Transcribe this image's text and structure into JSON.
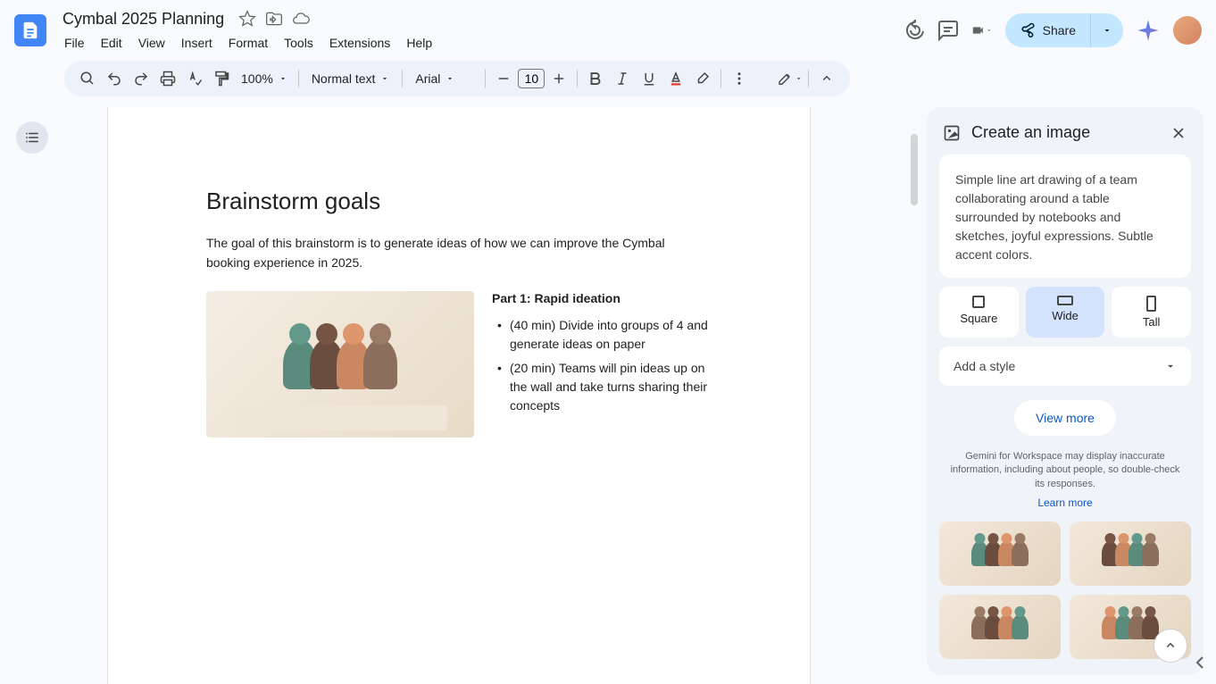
{
  "document": {
    "title": "Cymbal 2025 Planning",
    "menus": [
      "File",
      "Edit",
      "View",
      "Insert",
      "Format",
      "Tools",
      "Extensions",
      "Help"
    ]
  },
  "header": {
    "share_label": "Share"
  },
  "toolbar": {
    "zoom": "100%",
    "style": "Normal text",
    "font": "Arial",
    "font_size": "10"
  },
  "content": {
    "heading": "Brainstorm goals",
    "intro": "The goal of this brainstorm is to generate ideas of how we can improve the Cymbal booking experience in 2025.",
    "part_title": "Part 1: Rapid ideation",
    "bullets": [
      "(40 min) Divide into groups of 4 and generate ideas on paper",
      "(20 min) Teams will pin ideas up on the wall and take turns sharing their concepts"
    ]
  },
  "panel": {
    "title": "Create an image",
    "prompt": "Simple line art drawing of a team collaborating around a table surrounded by notebooks and sketches, joyful expressions. Subtle accent colors.",
    "ratios": {
      "square": "Square",
      "wide": "Wide",
      "tall": "Tall"
    },
    "style_placeholder": "Add a style",
    "view_more": "View more",
    "disclaimer": "Gemini for Workspace may display inaccurate information, including about people, so double-check its responses.",
    "learn_more": "Learn more"
  }
}
